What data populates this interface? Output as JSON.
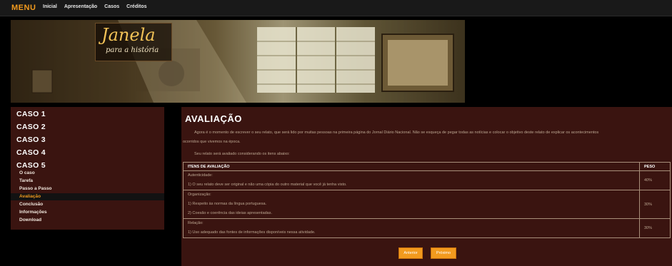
{
  "topbar": {
    "brand": "MENU",
    "nav": [
      "Inicial",
      "Apresentação",
      "Casos",
      "Créditos"
    ]
  },
  "banner": {
    "logo_title": "Janela",
    "logo_subtitle": "para a história"
  },
  "sidebar": {
    "cases": [
      "CASO 1",
      "CASO 2",
      "CASO 3",
      "CASO 4",
      "CASO 5"
    ],
    "submenu": [
      "O caso",
      "Tarefa",
      "Passo a Passo",
      "Avaliação",
      "Conclusão",
      "Informações",
      "Download"
    ],
    "active_index": 3
  },
  "main": {
    "title": "AVALIAÇÃO",
    "intro_line1": "Agora é o momento de escrever o seu relato, que será lido por muitas pessoas na primeira página do Jornal Diário Nacional. Não se esqueça de pegar todas as notícias e colocar o objetivo deste relato de explicar os acontecimentos",
    "intro_line2": "ocorridos que vivemos na época.",
    "intro_line3": "Seu relato será avaliado considerando os itens abaixo:",
    "table": {
      "headers": [
        "ITENS DE AVALIAÇÃO",
        "PESO"
      ],
      "rows": [
        {
          "lines": [
            "Autenticidade:",
            "1) O seu relato deve ser original e não uma cópia do outro material que você já tenha visto."
          ],
          "weight": "40%"
        },
        {
          "lines": [
            "Organização:",
            "1) Respeito às normas da língua portuguesa.",
            "2) Coesão e coerência das ideias apresentadas."
          ],
          "weight": "30%"
        },
        {
          "lines": [
            "Relação:",
            "1) Uso adequado das fontes de informações disponíveis nessa atividade."
          ],
          "weight": "30%"
        }
      ]
    },
    "buttons": [
      "Anterior",
      "Próximo"
    ]
  }
}
